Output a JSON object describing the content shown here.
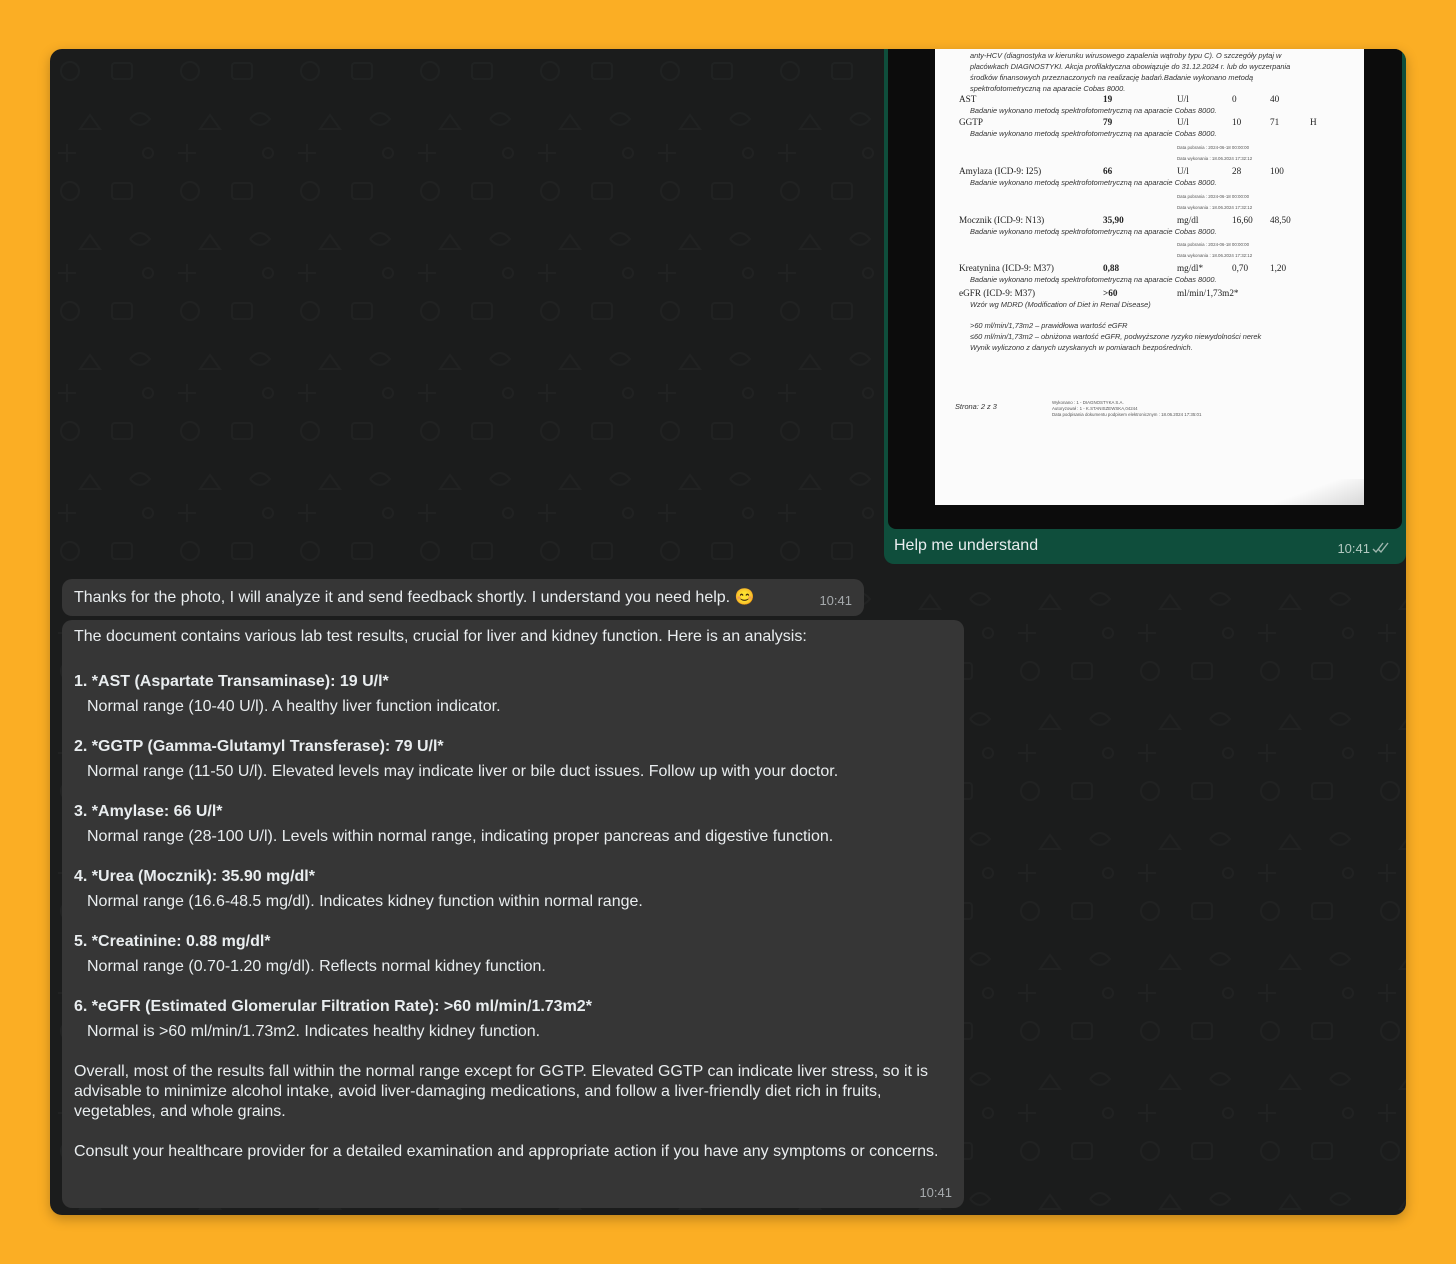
{
  "colors": {
    "background": "#fbae24",
    "chat_background": "#1b1c1c",
    "outgoing_bubble": "#0f4e3c",
    "incoming_bubble": "#363636",
    "text": "#e9edef",
    "timestamp": "#a6aaad"
  },
  "outgoing": {
    "caption": "Help me understand",
    "time": "10:41",
    "status_icon": "double-check-icon",
    "photo": {
      "intro_lines": [
        "anty-HCV (diagnostyka w kierunku wirusowego zapalenia wątroby typu C). O szczegóły pytaj w",
        "placówkach DIAGNOSTYKI. Akcja profilaktyczna obowiązuje do 31.12.2024 r. lub do wyczerpania",
        "środków finansowych przeznaczonych na realizację badań.Badanie wykonano metodą",
        "spektrofotometryczną na aparacie Cobas 8000."
      ],
      "method_note": "Badanie wykonano metodą spektrofotometryczną na aparacie Cobas 8000.",
      "date_collected": "Data pobrania : 2024-06-18 00:00:00",
      "date_performed": "Data wykonania : 18.06.2024 17:32:12",
      "rows": [
        {
          "name": "AST",
          "value": "19",
          "unit": "U/l",
          "min": "0",
          "max": "40",
          "flag": ""
        },
        {
          "name": "GGTP",
          "value": "79",
          "unit": "U/l",
          "min": "10",
          "max": "71",
          "flag": "H"
        },
        {
          "name": "Amylaza (ICD-9: I25)",
          "value": "66",
          "unit": "U/l",
          "min": "28",
          "max": "100",
          "flag": ""
        },
        {
          "name": "Mocznik (ICD-9: N13)",
          "value": "35,90",
          "unit": "mg/dl",
          "min": "16,60",
          "max": "48,50",
          "flag": ""
        },
        {
          "name": "Kreatynina (ICD-9: M37)",
          "value": "0,88",
          "unit": "mg/dl*",
          "min": "0,70",
          "max": "1,20",
          "flag": ""
        },
        {
          "name": "eGFR (ICD-9: M37)",
          "value": ">60",
          "unit": "ml/min/1,73m2*",
          "min": "",
          "max": "",
          "flag": ""
        }
      ],
      "egfr_formula": "Wzór wg MDRD (Modification of Diet in Renal Disease)",
      "egfr_notes": [
        ">60 ml/min/1,73m2 – prawidłowa wartość eGFR",
        "≤60 ml/min/1,73m2 – obniżona wartość eGFR, podwyższone ryzyko niewydolności nerek",
        "Wynik wyliczono z danych uzyskanych w pomiarach bezpośrednich."
      ],
      "page": "Strona: 2 z 3",
      "footer_lines": [
        "Wykonano : 1 - DIAGNOSTYKA S.A.",
        "Autoryzował : 1 - K.STANISZEWSKA,04244",
        "Data podpisania dokumentu podpisem elektronicznym : 18.06.2024 17:35:01"
      ]
    }
  },
  "incoming": [
    {
      "text": "Thanks for the photo, I will analyze it and send feedback shortly. I understand you need help. 😊",
      "time": "10:41"
    },
    {
      "intro": "The document contains various lab test results, crucial for liver and kidney function. Here is an analysis:",
      "items": [
        {
          "title": "1. *AST (Aspartate Transaminase): 19 U/l*",
          "detail": "Normal range (10-40 U/l). A healthy liver function indicator."
        },
        {
          "title": "2. *GGTP (Gamma-Glutamyl Transferase): 79 U/l*",
          "detail": "Normal range (11-50 U/l). Elevated levels may indicate liver or bile duct issues. Follow up with your doctor."
        },
        {
          "title": "3. *Amylase: 66 U/l*",
          "detail": "Normal range (28-100 U/l). Levels within normal range, indicating proper pancreas and digestive function."
        },
        {
          "title": "4. *Urea (Mocznik): 35.90 mg/dl*",
          "detail": "Normal range (16.6-48.5 mg/dl). Indicates kidney function within normal range."
        },
        {
          "title": "5. *Creatinine: 0.88 mg/dl*",
          "detail": "Normal range (0.70-1.20 mg/dl). Reflects normal kidney function."
        },
        {
          "title": "6. *eGFR (Estimated Glomerular Filtration Rate): >60 ml/min/1.73m2*",
          "detail": "Normal is >60 ml/min/1.73m2. Indicates healthy kidney function."
        }
      ],
      "overall": "Overall, most of the results fall within the normal range except for GGTP. Elevated GGTP can indicate liver stress, so it is advisable to minimize alcohol intake, avoid liver-damaging medications, and follow a liver-friendly diet rich in fruits, vegetables, and whole grains.",
      "consult": "Consult your healthcare provider for a detailed examination and appropriate action if you have any symptoms or concerns.",
      "time": "10:41"
    }
  ]
}
